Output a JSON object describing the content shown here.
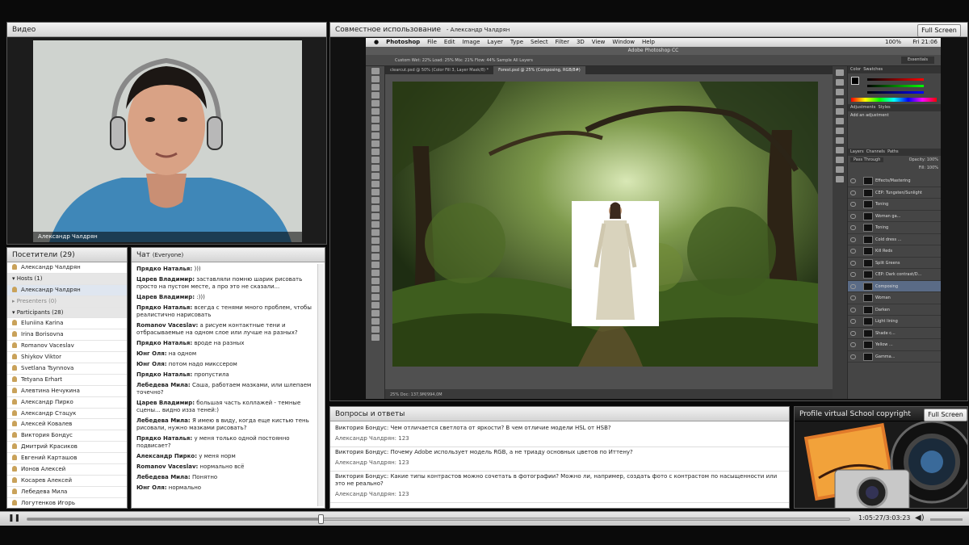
{
  "video": {
    "title": "Видео",
    "speaker_name": "Александр Чалдрян"
  },
  "attendees": {
    "title": "Посетители",
    "count": "(29)",
    "me": "Александр Чалдрян",
    "hosts_label": "Hosts (1)",
    "host": "Александр Чалдрян",
    "presenters_label": "Presenters (0)",
    "participants_label": "Participants (28)",
    "participants": [
      "Eluniina Karina",
      "Irina Borisovna",
      "Romanov Vaceslav",
      "Shiykov Viktor",
      "Svetlana Tsynnova",
      "Tetyana Erhart",
      "Алевтина Нечукина",
      "Александр Пирко",
      "Александр Стацук",
      "Алексей Ковалев",
      "Виктория Бондус",
      "Дмитрий Красиков",
      "Евгений Карташов",
      "Ионов Алексей",
      "Косарев Алексей",
      "Лебедева Мила",
      "Логутенков Игорь"
    ]
  },
  "chat": {
    "title": "Чат",
    "scope": "(Everyone)",
    "messages": [
      {
        "author": "Прядко Наталья:",
        "text": " )))"
      },
      {
        "author": "Царев Владимир:",
        "text": " заставляли помню шарик рисовать просто на пустом месте, а про это не сказали..."
      },
      {
        "author": "Царев Владимир:",
        "text": " :)))"
      },
      {
        "author": "Прядко Наталья:",
        "text": " всегда с тенями  много проблем, чтобы реалистично нарисовать"
      },
      {
        "author": "Romanov Vaceslav:",
        "text": " а рисуем контактные тени и отбрасываемые на одном слое или лучше на разных?"
      },
      {
        "author": "Прядко Наталья:",
        "text": " вроде на разных"
      },
      {
        "author": "Юнг Оля:",
        "text": " на одном"
      },
      {
        "author": "Юнг Оля:",
        "text": " потом надо микссером"
      },
      {
        "author": "Прядко Наталья:",
        "text": " пропустила"
      },
      {
        "author": "Лебедева Мила:",
        "text": " Саша, работаем мазками, или шлепаем точечно?"
      },
      {
        "author": "Царев Владимир:",
        "text": " большая часть коллажей - темные сцены... видно изза теней:)"
      },
      {
        "author": "Лебедева Мила:",
        "text": " Я имею в виду, когда еще кистью тень рисовали, нужно мазками рисовать?"
      },
      {
        "author": "Прядко Наталья:",
        "text": " у меня только одной постоянно подвисает?"
      },
      {
        "author": "Александр Пирко:",
        "text": " у меня норм"
      },
      {
        "author": "Romanov Vaceslav:",
        "text": " нормально всё"
      },
      {
        "author": "Лебедева Мила:",
        "text": " Понятно"
      },
      {
        "author": "Юнг Оля:",
        "text": " нормально"
      }
    ]
  },
  "share": {
    "title": "Совместное использование",
    "presenter": "- Александр Чалдрян",
    "fullscreen": "Full Screen"
  },
  "photoshop": {
    "menu": [
      "Photoshop",
      "File",
      "Edit",
      "Image",
      "Layer",
      "Type",
      "Select",
      "Filter",
      "3D",
      "View",
      "Window",
      "Help"
    ],
    "clock": "Fri 21:06",
    "battery": "100%",
    "app_title": "Adobe Photoshop CC",
    "options": "Custom    Wet: 22%    Load: 25%    Mix: 21%    Flow: 44%    Sample All Layers",
    "tabs": [
      "clearcut.psd @ 50% (Color Fill 3, Layer Mask/8) *",
      "Forest.psd @ 25% (Composing, RGB/8#)"
    ],
    "status": "25%        Doc: 137,9M/994,0M",
    "workspace": "Essentials",
    "panel_tabs": [
      "Color",
      "Swatches"
    ],
    "adj_tabs": [
      "Adjustments",
      "Styles"
    ],
    "adj_hint": "Add an adjustment",
    "layer_tabs": [
      "Layers",
      "Channels",
      "Paths"
    ],
    "blend": "Pass Through",
    "opacity": "Opacity: 100%",
    "fill": "Fill: 100%",
    "layers": [
      "Effects/Mastering",
      "CEP: Tungsten/Sunlight",
      "Toning",
      "Woman ga...",
      "Toning",
      "Cold dress ...",
      "Kill Reds",
      "Split Greens",
      "CEP: Dark contrast/D...",
      "Composing",
      "Woman",
      "Darken",
      "Light lining",
      "Shade c...",
      "Yellow ...",
      "Gamma..."
    ]
  },
  "qa": {
    "title": "Вопросы и ответы",
    "items": [
      {
        "q": "Виктория Бондус: Чем отличается светлота от яркости? В чем отличие модели HSL от HSB?",
        "a": "Александр Чалдрян: 123"
      },
      {
        "q": "Виктория Бондус: Почему Adobe использует модель RGB, а не триаду основных цветов по Иттену?",
        "a": "Александр Чалдрян: 123"
      },
      {
        "q": "Виктория Бондус: Какие типы контрастов можно сочетать в фотографии? Можно ли, например, создать фото с контрастом по насыщенности или это не реально?",
        "a": "Александр Чалдрян: 123"
      }
    ]
  },
  "profile": {
    "title": "Profile virtual School copyright",
    "fullscreen": "Full Screen"
  },
  "playback": {
    "time": "1:05:27/3:03:23",
    "progress": 0.357
  }
}
